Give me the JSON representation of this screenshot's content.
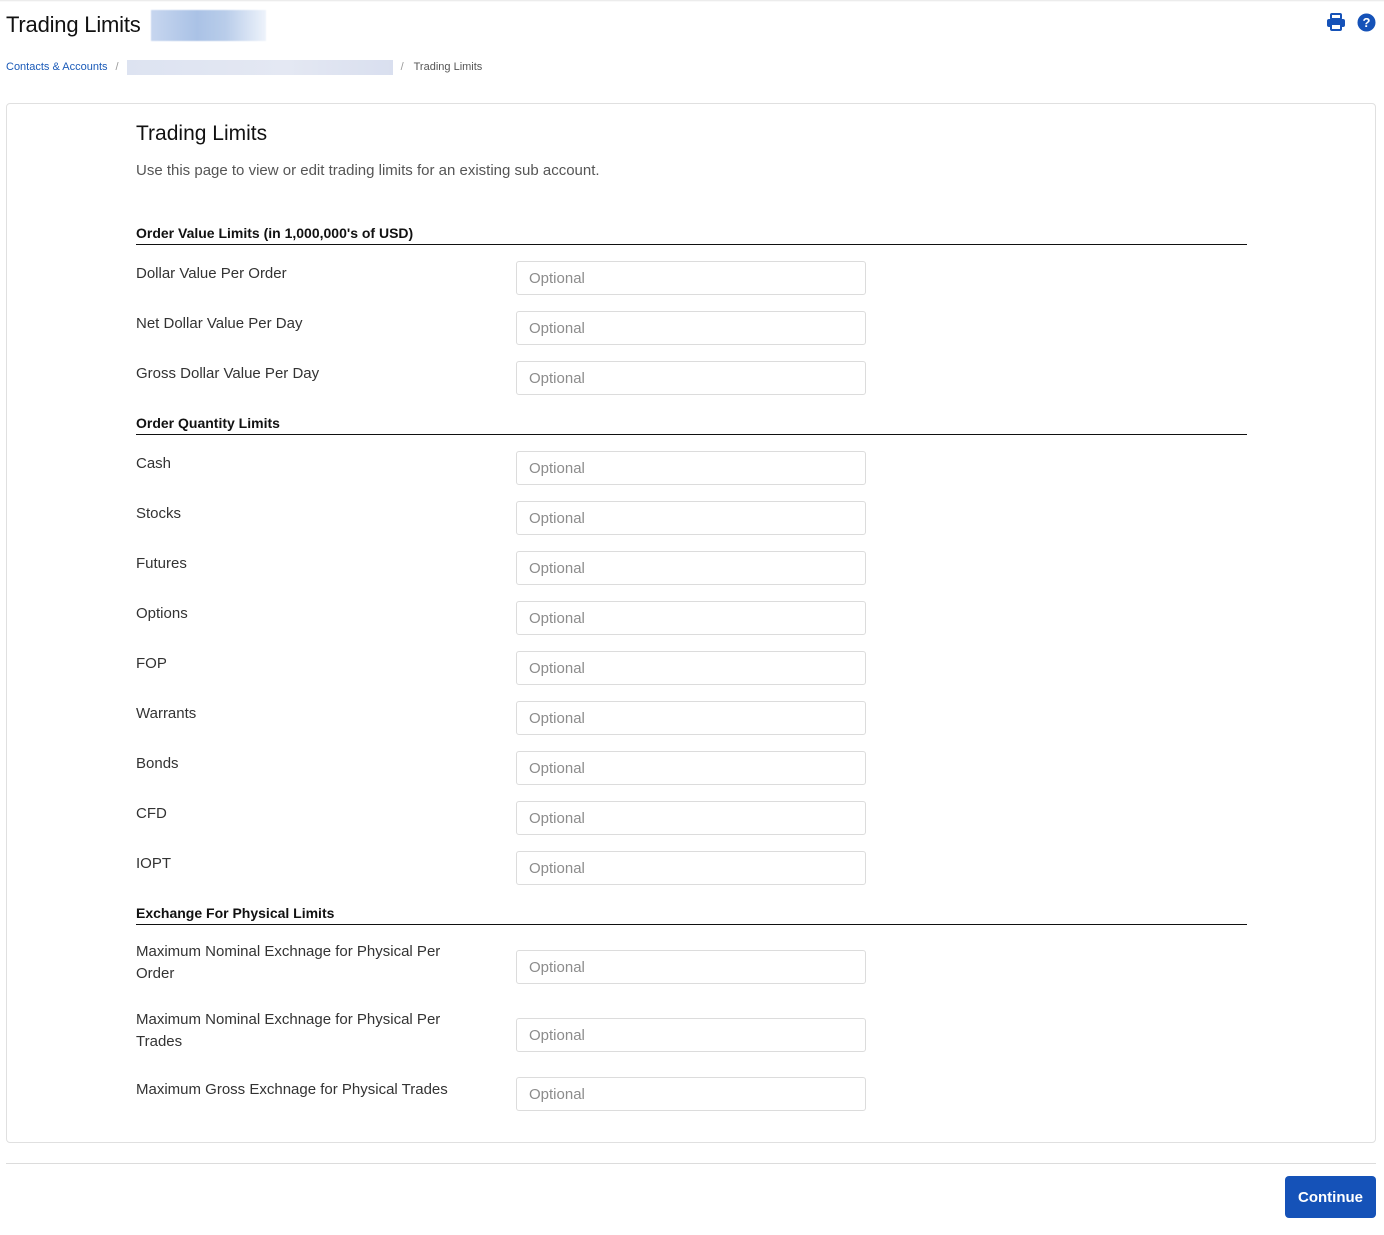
{
  "header": {
    "title": "Trading Limits",
    "icons": [
      {
        "name": "print-icon",
        "color": "#1552b8"
      },
      {
        "name": "help-icon",
        "color": "#1552b8"
      }
    ]
  },
  "breadcrumb": {
    "items": [
      {
        "label": "Contacts & Accounts",
        "link": true
      },
      {
        "label": "",
        "redacted": true
      },
      {
        "label": "Trading Limits",
        "current": true
      }
    ],
    "separator": "/"
  },
  "form": {
    "title": "Trading Limits",
    "description": "Use this page to view or edit trading limits for an existing sub account.",
    "sections": [
      {
        "title": "Order Value Limits (in 1,000,000's of USD)",
        "fields": [
          {
            "label": "Dollar Value Per Order",
            "value": "",
            "placeholder": "Optional"
          },
          {
            "label": "Net Dollar Value Per Day",
            "value": "",
            "placeholder": "Optional"
          },
          {
            "label": "Gross Dollar Value Per Day",
            "value": "",
            "placeholder": "Optional"
          }
        ]
      },
      {
        "title": "Order Quantity Limits",
        "fields": [
          {
            "label": "Cash",
            "value": "",
            "placeholder": "Optional"
          },
          {
            "label": "Stocks",
            "value": "",
            "placeholder": "Optional"
          },
          {
            "label": "Futures",
            "value": "",
            "placeholder": "Optional"
          },
          {
            "label": "Options",
            "value": "",
            "placeholder": "Optional"
          },
          {
            "label": "FOP",
            "value": "",
            "placeholder": "Optional"
          },
          {
            "label": "Warrants",
            "value": "",
            "placeholder": "Optional"
          },
          {
            "label": "Bonds",
            "value": "",
            "placeholder": "Optional"
          },
          {
            "label": "CFD",
            "value": "",
            "placeholder": "Optional"
          },
          {
            "label": "IOPT",
            "value": "",
            "placeholder": "Optional"
          }
        ]
      },
      {
        "title": "Exchange For Physical Limits",
        "fields": [
          {
            "label": "Maximum Nominal Exchnage for Physical Per Order",
            "value": "",
            "placeholder": "Optional"
          },
          {
            "label": "Maximum Nominal Exchnage for Physical Per Trades",
            "value": "",
            "placeholder": "Optional"
          },
          {
            "label": "Maximum Gross Exchnage for Physical Trades",
            "value": "",
            "placeholder": "Optional"
          }
        ]
      }
    ]
  },
  "footer": {
    "continue_label": "Continue",
    "accent": "#1552b8"
  }
}
